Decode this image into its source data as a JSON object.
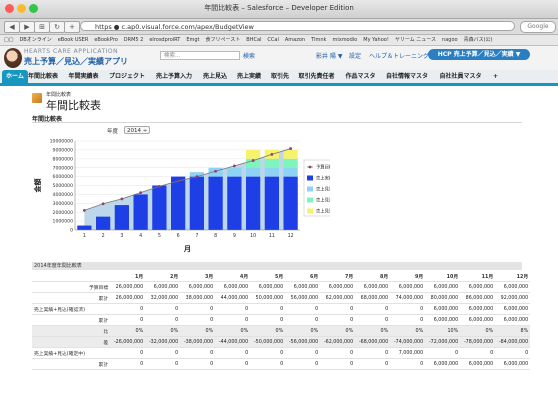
{
  "window": {
    "title": "年間比較表 – Salesforce – Developer Edition"
  },
  "browser": {
    "url": "https ● c.ap0.visual.force.com/apex/BudgetView",
    "search_placeholder": "Google",
    "nav_glyphs": [
      "◀",
      "▶",
      "⊞",
      "↻",
      "+"
    ],
    "bookmarks": [
      "□□",
      "DBオンライン",
      "eBook USER",
      "eBookPro",
      "DRM5 2",
      "elrosdproiRT",
      "Emgt",
      "食フリペースト",
      "BHCal",
      "CCal",
      "Amazon",
      "Tlmnk",
      "mixmodio",
      "My Yahoo!",
      "ヤリーム ニュース",
      "nagoo",
      "青森バス(公)"
    ]
  },
  "app": {
    "name_top": "HEARTS CARE APPLICATION",
    "name": "売上予算／見込／実績アプリ",
    "search_placeholder": "検索...",
    "search_button": "検索",
    "user_menu": "影井 陽 ▼",
    "setup": "設定",
    "help": "ヘルプ＆トレーニング",
    "app_switcher": "HCP 売上予算／見込／実績 ▼"
  },
  "tabs": [
    "ホーム",
    "年間比較表",
    "年間実績表",
    "プロジェクト",
    "売上予算入力",
    "売上見込",
    "売上実績",
    "取引先",
    "取引先責任者",
    "作品マスタ",
    "自社情報マスタ",
    "自社社員マスタ",
    "+"
  ],
  "page": {
    "sub": "年間比較表",
    "title": "年間比較表"
  },
  "section": {
    "title": "年間比較表",
    "year_label": "年度",
    "year_value": "2014 ÷"
  },
  "chart_data": {
    "type": "bar",
    "categories": [
      "1",
      "2",
      "3",
      "4",
      "5",
      "6",
      "7",
      "8",
      "9",
      "10",
      "11",
      "12"
    ],
    "xlabel": "月",
    "ylabel": "金額",
    "ylim": [
      0,
      10000000
    ],
    "yticks": [
      "0",
      "1000000",
      "2000000",
      "3000000",
      "4000000",
      "5000000",
      "6000000",
      "7000000",
      "8000000",
      "9000000",
      "10000000"
    ],
    "series": [
      {
        "name": "予算目標",
        "type": "line",
        "color": "#9b3c70",
        "values": [
          2200000,
          2950000,
          3500000,
          4200000,
          4900000,
          5500000,
          6000000,
          6600000,
          7200000,
          7800000,
          8500000,
          9150000
        ]
      },
      {
        "name": "売上実績",
        "type": "bar",
        "color": "#1f3fe6",
        "values": [
          500000,
          1500000,
          2800000,
          4000000,
          5000000,
          6000000,
          6000000,
          6000000,
          6000000,
          6000000,
          6000000,
          6000000
        ]
      },
      {
        "name": "売上見込(確定前)",
        "type": "bar",
        "color": "#8fd3f4",
        "values": [
          0,
          0,
          0,
          0,
          0,
          0,
          500000,
          1000000,
          1000000,
          1000000,
          1000000,
          1000000
        ]
      },
      {
        "name": "売上見込(確定中)",
        "type": "bar",
        "color": "#7ef5bd",
        "values": [
          0,
          0,
          0,
          0,
          0,
          0,
          0,
          0,
          0,
          1000000,
          1000000,
          1000000
        ]
      },
      {
        "name": "売上見込(確定済)",
        "type": "bar",
        "color": "#f7f26b",
        "values": [
          0,
          0,
          0,
          0,
          0,
          0,
          0,
          0,
          0,
          1000000,
          1000000,
          1000000
        ]
      }
    ],
    "area_color": "#bcd6ea",
    "legend_position": "right"
  },
  "table": {
    "title": "2014年度年間比較表",
    "months": [
      "1月",
      "2月",
      "3月",
      "4月",
      "5月",
      "6月",
      "7月",
      "8月",
      "9月",
      "10月",
      "11月",
      "12月"
    ],
    "rows": [
      {
        "group": "",
        "label": "予算目標",
        "shade": false,
        "values": [
          "26,000,000",
          "6,000,000",
          "6,000,000",
          "6,000,000",
          "6,000,000",
          "6,000,000",
          "6,000,000",
          "6,000,000",
          "6,000,000",
          "6,000,000",
          "6,000,000",
          "6,000,000"
        ]
      },
      {
        "group": "",
        "label": "累計",
        "shade": false,
        "values": [
          "26,000,000",
          "32,000,000",
          "38,000,000",
          "44,000,000",
          "50,000,000",
          "56,000,000",
          "62,000,000",
          "68,000,000",
          "74,000,000",
          "80,000,000",
          "86,000,000",
          "92,000,000"
        ]
      },
      {
        "group": "売上実績+見込(確認済)",
        "label": "",
        "shade": false,
        "values": [
          "0",
          "0",
          "0",
          "0",
          "0",
          "0",
          "0",
          "0",
          "0",
          "6,000,000",
          "6,000,000",
          "6,000,000"
        ]
      },
      {
        "group": "",
        "label": "累計",
        "shade": false,
        "values": [
          "0",
          "0",
          "0",
          "0",
          "0",
          "0",
          "0",
          "0",
          "0",
          "6,000,000",
          "6,000,000",
          "6,000,000"
        ]
      },
      {
        "group": "",
        "label": "比",
        "shade": true,
        "values": [
          "0%",
          "0%",
          "0%",
          "0%",
          "0%",
          "0%",
          "0%",
          "0%",
          "0%",
          "10%",
          "0%",
          "8%"
        ]
      },
      {
        "group": "",
        "label": "差",
        "shade": true,
        "values": [
          "-26,000,000",
          "-32,000,000",
          "-38,000,000",
          "-44,000,000",
          "-50,000,000",
          "-56,000,000",
          "-62,000,000",
          "-68,000,000",
          "-74,000,000",
          "-72,000,000",
          "-78,000,000",
          "-84,000,000"
        ]
      },
      {
        "group": "売上実績+見込(確定中)",
        "label": "",
        "shade": false,
        "values": [
          "0",
          "0",
          "0",
          "0",
          "0",
          "0",
          "0",
          "0",
          "7,000,000",
          "0",
          "0",
          "0"
        ]
      },
      {
        "group": "",
        "label": "累計",
        "shade": false,
        "values": [
          "0",
          "0",
          "0",
          "0",
          "0",
          "0",
          "0",
          "0",
          "0",
          "6,000,000",
          "6,000,000",
          "6,000,000"
        ]
      }
    ]
  }
}
